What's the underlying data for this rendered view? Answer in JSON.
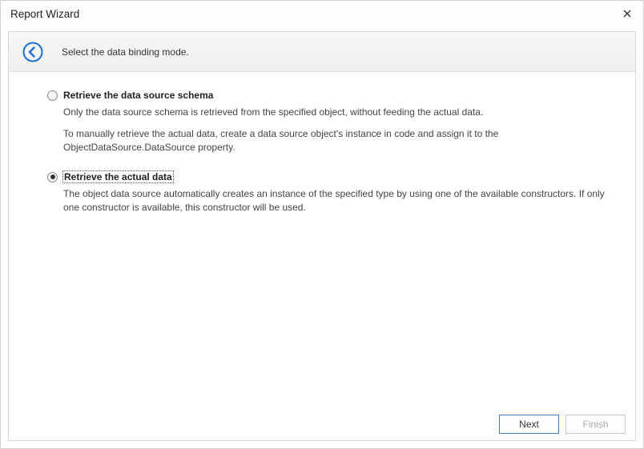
{
  "window": {
    "title": "Report Wizard"
  },
  "header": {
    "instruction": "Select the data binding mode."
  },
  "options": [
    {
      "label": "Retrieve the data source schema",
      "selected": false,
      "desc_paragraphs": [
        "Only the data source schema is retrieved from the specified object, without feeding the actual data.",
        "To manually retrieve the actual data, create a data source object's instance in code and assign it to the ObjectDataSource.DataSource property."
      ]
    },
    {
      "label": "Retrieve the actual data",
      "selected": true,
      "desc_paragraphs": [
        "The object data source automatically creates an instance of the specified type by using one of the available constructors. If only one constructor is available, this constructor will be used."
      ]
    }
  ],
  "buttons": {
    "next": "Next",
    "finish": "Finish"
  }
}
